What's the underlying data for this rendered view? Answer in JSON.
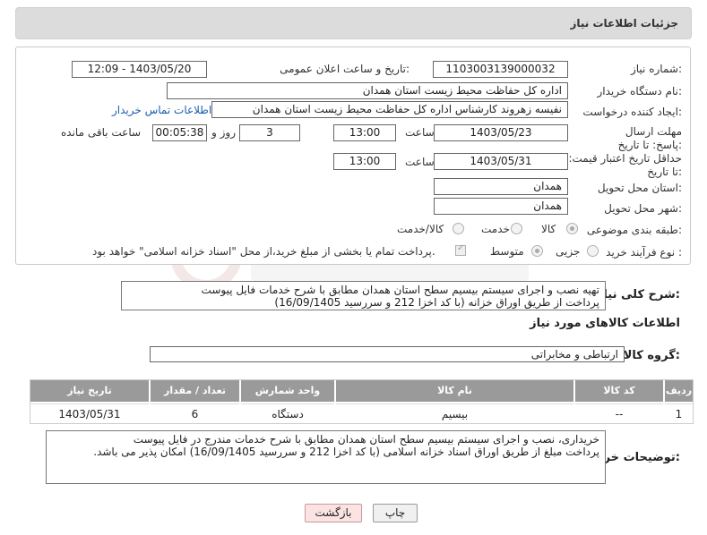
{
  "header": {
    "title": "جزئیات اطلاعات نیاز"
  },
  "need_number": {
    "label": "شماره نیاز:",
    "value": "1103003139000032"
  },
  "announce": {
    "label": "تاریخ و ساعت اعلان عمومی:",
    "value": "1403/05/20 - 12:09"
  },
  "buyer_org": {
    "label": "نام دستگاه خریدار:",
    "value": "اداره کل حفاظت محیط زیست استان همدان"
  },
  "requester": {
    "label": "ایجاد کننده درخواست:",
    "value": "نفیسه زهروند کارشناس  اداره کل حفاظت محیط زیست استان همدان",
    "contact_link": "اطلاعات تماس خریدار"
  },
  "deadline": {
    "label": "مهلت ارسال پاسخ: تا تاریخ:",
    "date": "1403/05/23",
    "time_label": "ساعت",
    "time": "13:00",
    "days": "3",
    "days_label": "روز و",
    "remaining": "00:05:38",
    "remaining_label": "ساعت باقی مانده"
  },
  "validity": {
    "label": "حداقل تاریخ اعتبار قیمت: تا تاریخ:",
    "date": "1403/05/31",
    "time_label": "ساعت",
    "time": "13:00"
  },
  "province": {
    "label": "استان محل تحویل:",
    "value": "همدان"
  },
  "city": {
    "label": "شهر محل تحویل:",
    "value": "همدان"
  },
  "category": {
    "label": "طبقه بندی موضوعی:",
    "options": [
      "کالا",
      "خدمت",
      "کالا/خدمت"
    ],
    "selected": "کالا"
  },
  "process": {
    "label": "نوع فرآیند خرید :",
    "options": [
      "جزیی",
      "متوسط"
    ],
    "note": "پرداخت تمام یا بخشی از مبلغ خرید،از محل \"اسناد خزانه اسلامی\" خواهد بود."
  },
  "summary": {
    "label": "شرح کلی نیاز:",
    "line1": "تهیه نصب و اجرای سیستم بیسیم سطح استان همدان مطابق با شرح خدمات فایل پیوست",
    "line2": "پرداخت از طریق اوراق خزانه (با کد اخزا 212 و سررسید 16/09/1405)"
  },
  "goods_info": {
    "title": "اطلاعات کالاهای مورد نیاز"
  },
  "goods_group": {
    "label": "گروه کالا:",
    "value": "ارتباطی و مخابراتی"
  },
  "table": {
    "headers": [
      "ردیف",
      "کد کالا",
      "نام کالا",
      "واحد شمارش",
      "تعداد / مقدار",
      "تاریخ نیاز"
    ],
    "rows": [
      [
        "1",
        "--",
        "بیسیم",
        "دستگاه",
        "6",
        "1403/05/31"
      ]
    ]
  },
  "buyer_desc": {
    "label": "توضیحات خریدار:",
    "line1": "خریداری، نصب و اجرای سیستم بیسیم سطح استان همدان مطابق با شرح خدمات مندرج در فایل پیوست",
    "line2": "پرداخت مبلغ از طریق اوراق اسناد خزانه اسلامی (با کد اخزا 212 و سررسید 16/09/1405)  امکان پذیر می باشد."
  },
  "buttons": {
    "print": "چاپ",
    "back": "بازگشت"
  },
  "colors": {
    "header_bg": "#dcdcdc",
    "link": "#1a5fb4",
    "table_header": "#9a9a9a",
    "back_button_bg": "#fbe3e3"
  }
}
